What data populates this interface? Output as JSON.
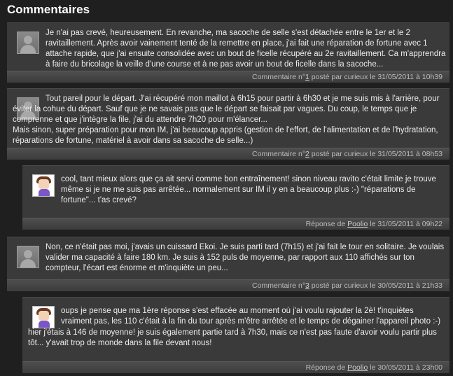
{
  "section": {
    "title": "Commentaires"
  },
  "comments": [
    {
      "text": "Je n'ai pas crevé, heureusement. En revanche, ma sacoche de selle s'est détachée entre le 1er et le 2 ravitaillement. Après avoir vainement tenté de la remettre en place, j'ai fait une réparation de fortune avec 1 attache rapide, que j'ai ensuite consolidée avec un bout de ficelle récupéré au 2e ravitaillement. Ca m'apprendra à faire du bricolage la veille d'une course et à ne pas avoir un bout de ficelle dans la sacoche...",
      "footer": {
        "prefix": "Commentaire n°",
        "num": "1",
        "by": " posté par curieux le 31/05/2011 à 10h39"
      }
    },
    {
      "text": "Tout pareil pour le départ. J'ai récupéré mon maillot à 6h15 pour partir à 6h30 et je me suis mis à l'arrière, pour éviter la cohue du départ. Sauf que je ne savais pas que le départ se faisait par vagues. Du coup, le temps que je comprenne et que j'intègre la file, j'ai du attendre 7h20 pour m'élancer...\nMais sinon, super préparation pour mon IM, j'ai beaucoup appris (gestion de l'effort, de l'alimentation et de l'hydratation, réparations de fortune, matériel à avoir dans sa sacoche de selle...)",
      "footer": {
        "prefix": "Commentaire n°",
        "num": "2",
        "by": " posté par curieux le 31/05/2011 à 08h53"
      }
    },
    {
      "text": "cool, tant mieux alors que ça ait servi comme bon entraînement! sinon niveau ravito c'était limite je trouve même si je ne me suis pas arrêtée... normalement sur IM il y en a beaucoup plus :-) \"réparations de fortune\"... t'as crevé?",
      "footer": {
        "prefix": "Réponse de ",
        "author": "Poolio",
        "date": " le 31/05/2011 à 09h22"
      }
    },
    {
      "text": "Non, ce n'était pas moi, j'avais un cuissard Ekoi. Je suis parti tard (7h15) et j'ai fait le tour en solitaire. Je voulais valider ma capacité à faire 180 km. Je suis à 152 puls de moyenne, par rapport aux 110 affichés sur ton compteur, l'écart est énorme et m'inquiète un peu...",
      "footer": {
        "prefix": "Commentaire n°",
        "num": "3",
        "by": " posté par curieux le 30/05/2011 à 21h33"
      }
    },
    {
      "text": "oups je pense que ma 1ère réponse s'est effacée au moment où j'ai voulu rajouter la 2è! t'inquiètes vraiment pas, les 110 c'était à la fin du tour après m'être arrêtée et le temps de dégainer l'appareil photo :-)",
      "text2": "hier j'étais à 146 de moyenne! je suis également partie tard à 7h30, mais ce n'est pas faute d'avoir voulu partir plus tôt... y'avait trop de monde dans la file devant nous!",
      "footer": {
        "prefix": "Réponse de ",
        "author": "Poolio",
        "date": " le 30/05/2011 à 23h00"
      }
    }
  ]
}
